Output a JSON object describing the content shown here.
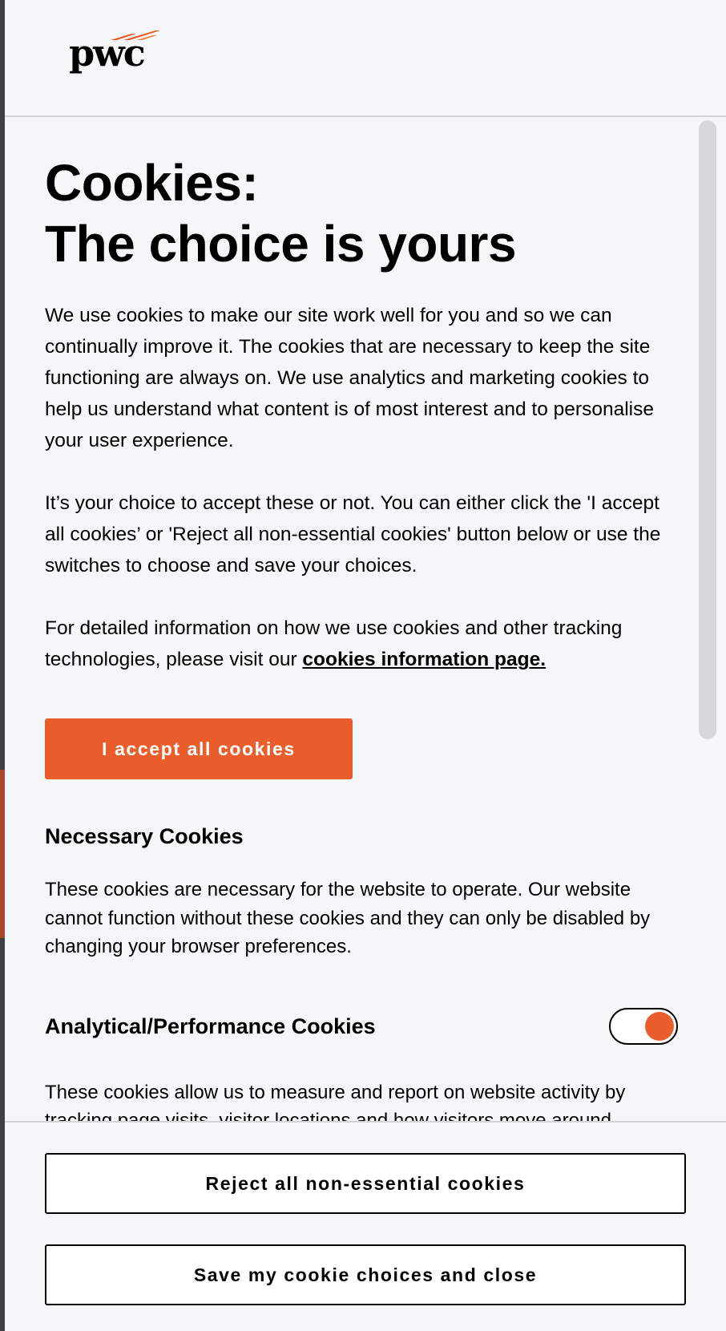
{
  "brand": {
    "logo_text": "pwc",
    "accent_color": "#ea5e2d"
  },
  "dialog": {
    "title_line1": "Cookies:",
    "title_line2": "The choice is yours",
    "intro": "We use cookies to make our site work well for you and so we can continually improve it. The cookies that are necessary to keep the site functioning are always on. We use analytics and marketing cookies to help us understand what content is of most interest and to personalise your user experience.",
    "choice": "It’s your choice to accept these or not. You can either click the 'I accept all cookies’ or 'Reject all non-essential cookies' button below or use the switches to choose and save your choices.",
    "info_prefix": "For detailed information on how we use cookies and other tracking technologies, please visit our ",
    "info_link": "cookies information page.",
    "accept_button": "I accept all cookies"
  },
  "sections": {
    "necessary": {
      "title": "Necessary Cookies",
      "description": "These cookies are necessary for the website to operate. Our website cannot function without these cookies and they can only be disabled by changing your browser preferences."
    },
    "analytical": {
      "title": "Analytical/Performance Cookies",
      "toggle_on": true,
      "description": "These cookies allow us to measure and report on website activity by tracking page visits, visitor locations and how visitors move around"
    }
  },
  "footer": {
    "reject_button": "Reject all non-essential cookies",
    "save_button": "Save my cookie choices and close"
  }
}
